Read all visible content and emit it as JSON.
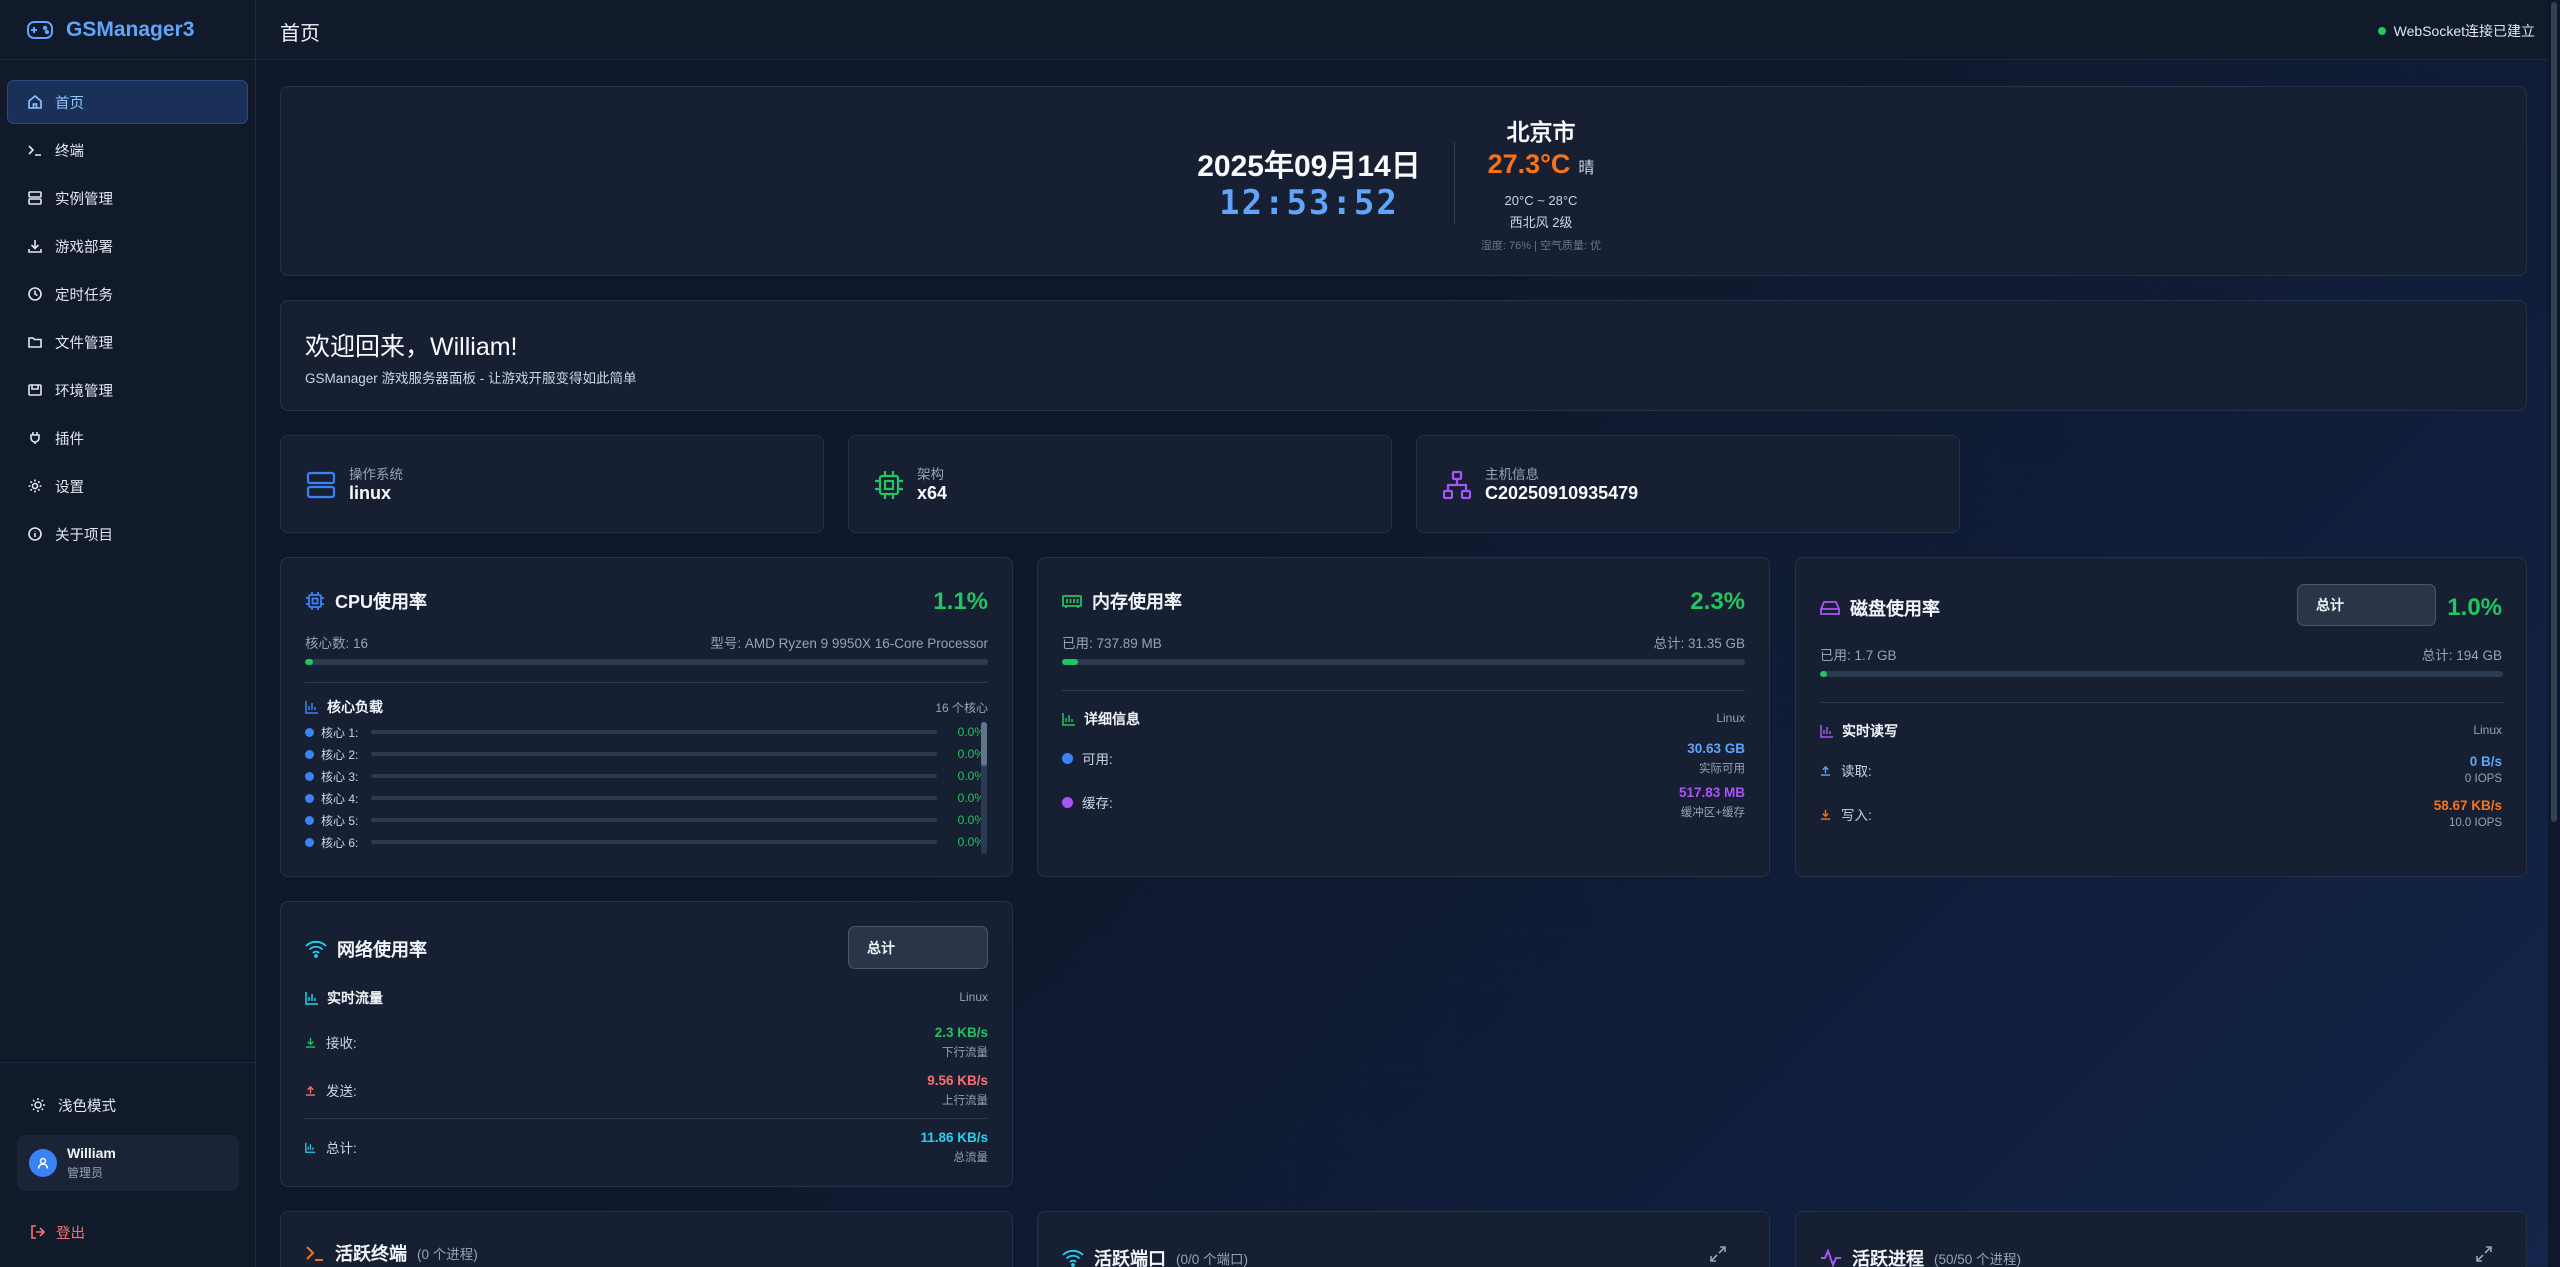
{
  "app": {
    "name": "GSManager3"
  },
  "sidebar": {
    "items": [
      {
        "label": "首页",
        "icon": "home-icon"
      },
      {
        "label": "终端",
        "icon": "terminal-icon"
      },
      {
        "label": "实例管理",
        "icon": "server-icon"
      },
      {
        "label": "游戏部署",
        "icon": "download-icon"
      },
      {
        "label": "定时任务",
        "icon": "clock-icon"
      },
      {
        "label": "文件管理",
        "icon": "folder-icon"
      },
      {
        "label": "环境管理",
        "icon": "package-icon"
      },
      {
        "label": "插件",
        "icon": "plugin-icon"
      },
      {
        "label": "设置",
        "icon": "gear-icon"
      },
      {
        "label": "关于项目",
        "icon": "info-icon"
      }
    ],
    "theme_label": "浅色模式",
    "user": {
      "name": "William",
      "role": "管理员"
    },
    "logout": "登出"
  },
  "header": {
    "title": "首页",
    "ws_status": "WebSocket连接已建立"
  },
  "clock": {
    "date": "2025年09月14日",
    "time": "12:53:52"
  },
  "weather": {
    "city": "北京市",
    "temp": "27.3°C",
    "condition": "晴",
    "range": "20°C ~ 28°C",
    "wind": "西北风 2级",
    "extra": "湿度: 76% | 空气质量: 优"
  },
  "welcome": {
    "title": "欢迎回来，William!",
    "subtitle": "GSManager 游戏服务器面板 - 让游戏开服变得如此简单"
  },
  "sysinfo": [
    {
      "label": "操作系统",
      "value": "linux",
      "icon": "server-icon"
    },
    {
      "label": "架构",
      "value": "x64",
      "icon": "cpu-icon"
    },
    {
      "label": "主机信息",
      "value": "C20250910935479",
      "icon": "network-icon"
    }
  ],
  "cpu": {
    "title": "CPU使用率",
    "percent": "1.1%",
    "usage": 0.011,
    "cores_label": "核心数: 16",
    "model_label": "型号: AMD Ryzen 9 9950X 16-Core Processor",
    "load_title": "核心负载",
    "load_count": "16 个核心",
    "cores": [
      {
        "name": "核心 1:",
        "value": "0.0%"
      },
      {
        "name": "核心 2:",
        "value": "0.0%"
      },
      {
        "name": "核心 3:",
        "value": "0.0%"
      },
      {
        "name": "核心 4:",
        "value": "0.0%"
      },
      {
        "name": "核心 5:",
        "value": "0.0%"
      },
      {
        "name": "核心 6:",
        "value": "0.0%"
      }
    ]
  },
  "memory": {
    "title": "内存使用率",
    "percent": "2.3%",
    "usage": 0.023,
    "used": "已用: 737.89 MB",
    "total": "总计: 31.35 GB",
    "detail_title": "详细信息",
    "os": "Linux",
    "available_label": "可用:",
    "available_value": "30.63 GB",
    "available_sub": "实际可用",
    "cache_label": "缓存:",
    "cache_value": "517.83 MB",
    "cache_sub": "缓冲区+缓存"
  },
  "disk": {
    "title": "磁盘使用率",
    "select": "总计",
    "percent": "1.0%",
    "usage": 0.01,
    "used": "已用: 1.7 GB",
    "total": "总计: 194 GB",
    "io_title": "实时读写",
    "os": "Linux",
    "read_label": "读取:",
    "read_value": "0 B/s",
    "read_iops": "0 IOPS",
    "write_label": "写入:",
    "write_value": "58.67 KB/s",
    "write_iops": "10.0 IOPS"
  },
  "network": {
    "title": "网络使用率",
    "select": "总计",
    "traffic_title": "实时流量",
    "os": "Linux",
    "rx_label": "接收:",
    "rx_value": "2.3 KB/s",
    "rx_sub": "下行流量",
    "tx_label": "发送:",
    "tx_value": "9.56 KB/s",
    "tx_sub": "上行流量",
    "total_label": "总计:",
    "total_value": "11.86 KB/s",
    "total_sub": "总流量"
  },
  "bottom": {
    "terminals_title": "活跃终端",
    "terminals_count": "(0 个进程)",
    "ports_title": "活跃端口",
    "ports_count": "(0/0 个端口)",
    "procs_title": "活跃进程",
    "procs_count": "(50/50 个进程)"
  },
  "colors": {
    "accent": "#60a5fa",
    "green": "#22c55e",
    "orange": "#f97316",
    "purple": "#a855f7",
    "cyan": "#22d3ee",
    "red": "#f87171"
  }
}
